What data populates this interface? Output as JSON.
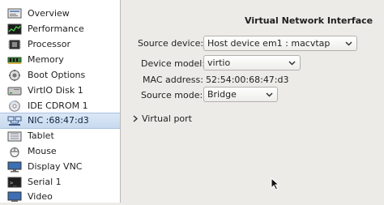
{
  "sidebar": {
    "items": [
      {
        "label": "Overview",
        "icon": "overview-icon"
      },
      {
        "label": "Performance",
        "icon": "performance-icon"
      },
      {
        "label": "Processor",
        "icon": "processor-icon"
      },
      {
        "label": "Memory",
        "icon": "memory-icon"
      },
      {
        "label": "Boot Options",
        "icon": "boot-options-icon"
      },
      {
        "label": "VirtIO Disk 1",
        "icon": "disk-icon"
      },
      {
        "label": "IDE CDROM 1",
        "icon": "cdrom-icon"
      },
      {
        "label": "NIC :68:47:d3",
        "icon": "nic-icon",
        "selected": true
      },
      {
        "label": "Tablet",
        "icon": "tablet-icon"
      },
      {
        "label": "Mouse",
        "icon": "mouse-icon"
      },
      {
        "label": "Display VNC",
        "icon": "display-icon"
      },
      {
        "label": "Serial 1",
        "icon": "serial-icon"
      },
      {
        "label": "Video",
        "icon": "video-icon"
      }
    ]
  },
  "detail": {
    "title": "Virtual Network Interface",
    "source_device_label": "Source device:",
    "source_device_value": "Host device em1 : macvtap",
    "device_model_label": "Device model:",
    "device_model_value": "virtio",
    "mac_label": "MAC address:",
    "mac_value": "52:54:00:68:47:d3",
    "source_mode_label": "Source mode:",
    "source_mode_value": "Bridge",
    "virtual_port_label": "Virtual port"
  },
  "colors": {
    "selection": "#c8daef",
    "pane_background": "#ecebe8"
  }
}
